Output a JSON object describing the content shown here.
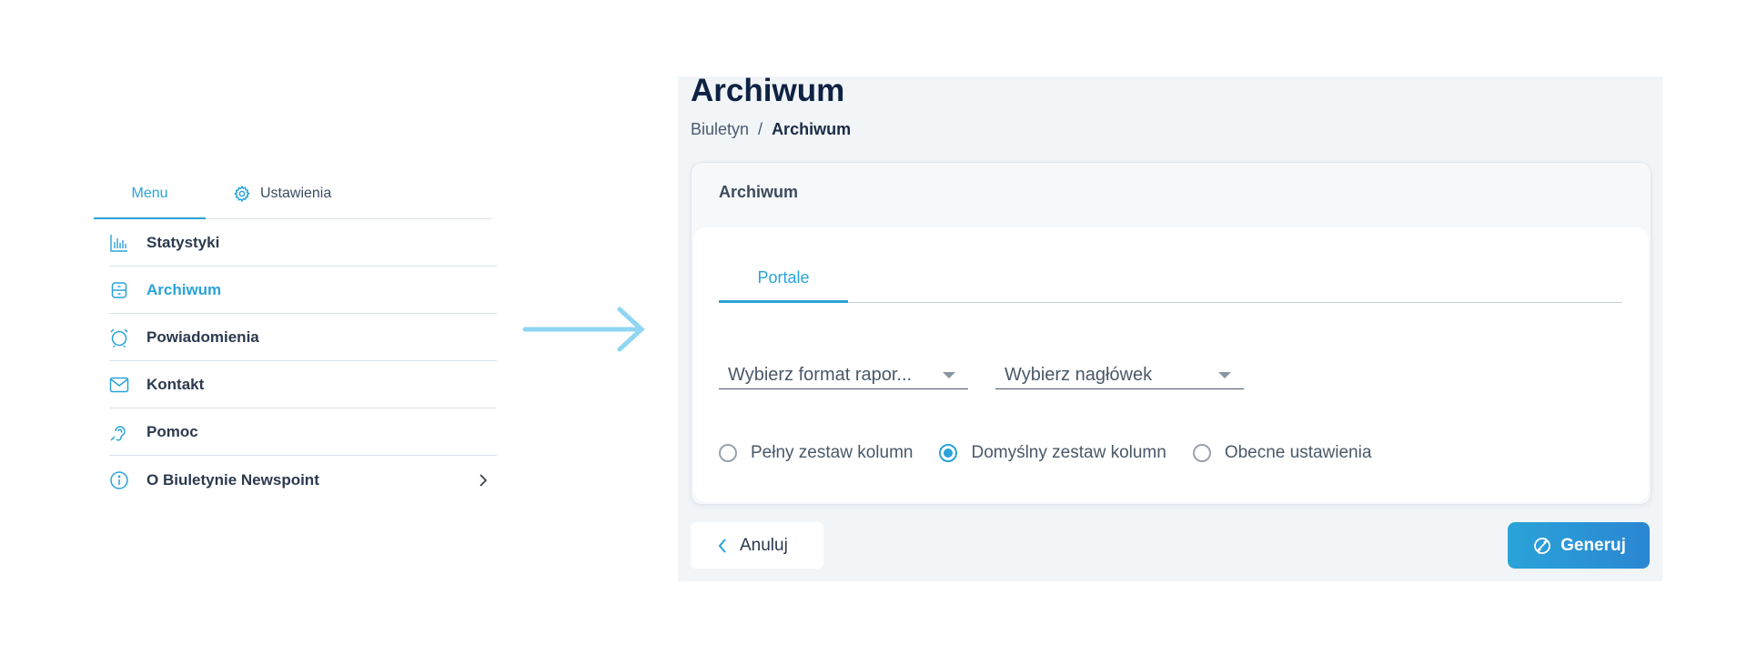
{
  "left_menu": {
    "tabs": [
      {
        "label": "Menu",
        "active": true
      },
      {
        "label": "Ustawienia",
        "icon": "gear-icon",
        "active": false
      }
    ],
    "items": [
      {
        "label": "Statystyki",
        "icon": "bar-chart-icon",
        "active": false
      },
      {
        "label": "Archiwum",
        "icon": "archive-icon",
        "active": true
      },
      {
        "label": "Powiadomienia",
        "icon": "alarm-clock-icon",
        "active": false
      },
      {
        "label": "Kontakt",
        "icon": "mail-icon",
        "active": false
      },
      {
        "label": "Pomoc",
        "icon": "help-icon",
        "active": false
      },
      {
        "label": "O Biuletynie Newspoint",
        "icon": "info-icon",
        "active": false,
        "has_submenu": true
      }
    ]
  },
  "flow_arrow": {
    "icon": "arrow-right-icon",
    "color": "#8fd6f2"
  },
  "page": {
    "title": "Archiwum",
    "breadcrumb": {
      "parent": "Biuletyn",
      "separator": "/",
      "current": "Archiwum"
    }
  },
  "card": {
    "title": "Archiwum",
    "tab": "Portale",
    "format_select": {
      "value": "Wybierz format rapor..."
    },
    "header_select": {
      "value": "Wybierz nagłówek"
    },
    "radios": [
      {
        "label": "Pełny zestaw kolumn",
        "checked": false
      },
      {
        "label": "Domyślny zestaw kolumn",
        "checked": true
      },
      {
        "label": "Obecne ustawienia",
        "checked": false
      }
    ]
  },
  "actions": {
    "cancel_label": "Anuluj",
    "generate_label": "Generuj"
  },
  "colors": {
    "accent": "#2aa3d8",
    "title": "#0f2243",
    "panel_bg": "#f1f5f8"
  }
}
